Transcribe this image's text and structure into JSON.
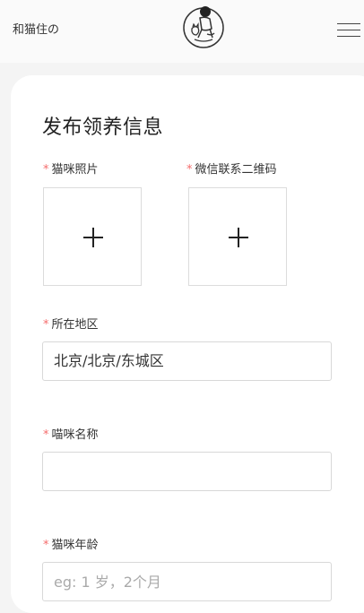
{
  "header": {
    "brand": "和猫住の",
    "logo_icon": "cat-person-logo-icon",
    "menu_icon": "hamburger-menu-icon"
  },
  "form": {
    "title": "发布领养信息",
    "required_mark": "*",
    "photo_label": "猫咪照片",
    "wechat_qr_label": "微信联系二维码",
    "upload_icon": "plus-icon",
    "location_label": "所在地区",
    "location_value": "北京/北京/东城区",
    "name_label": "喵咪名称",
    "name_value": "",
    "age_label": "猫咪年龄",
    "age_placeholder": "eg: 1 岁，2个月"
  },
  "colors": {
    "required": "#f56c6c",
    "page_bg": "#f4f4f4",
    "card_bg": "#ffffff"
  }
}
